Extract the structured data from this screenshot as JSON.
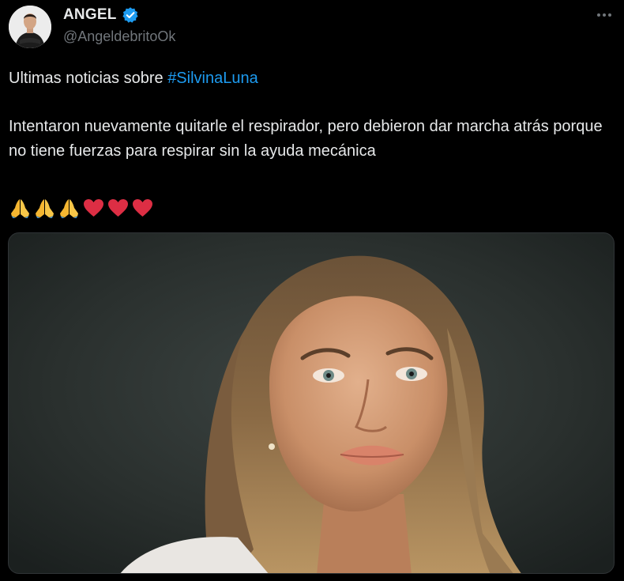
{
  "tweet": {
    "author": {
      "name": "ANGEL",
      "handle": "@AngeldebritoOk",
      "verified": true
    },
    "text": {
      "line1_prefix": "Ultimas noticias sobre ",
      "hashtag": "#SilvinaLuna",
      "paragraph2": "Intentaron nuevamente quitarle el respirador, pero debieron dar marcha atrás porque no tiene fuerzas para respirar sin la ayuda mecánica"
    },
    "emojis": [
      "folded-hands-icon",
      "folded-hands-icon",
      "folded-hands-icon",
      "red-heart-icon",
      "red-heart-icon",
      "red-heart-icon"
    ],
    "media": {
      "type": "photo"
    }
  },
  "colors": {
    "background": "#000000",
    "text": "#e7e9ea",
    "secondary_text": "#71767b",
    "link": "#1d9bf0",
    "verified_badge": "#1d9bf0",
    "heart": "#e0243b",
    "hands": "#f5b631"
  }
}
